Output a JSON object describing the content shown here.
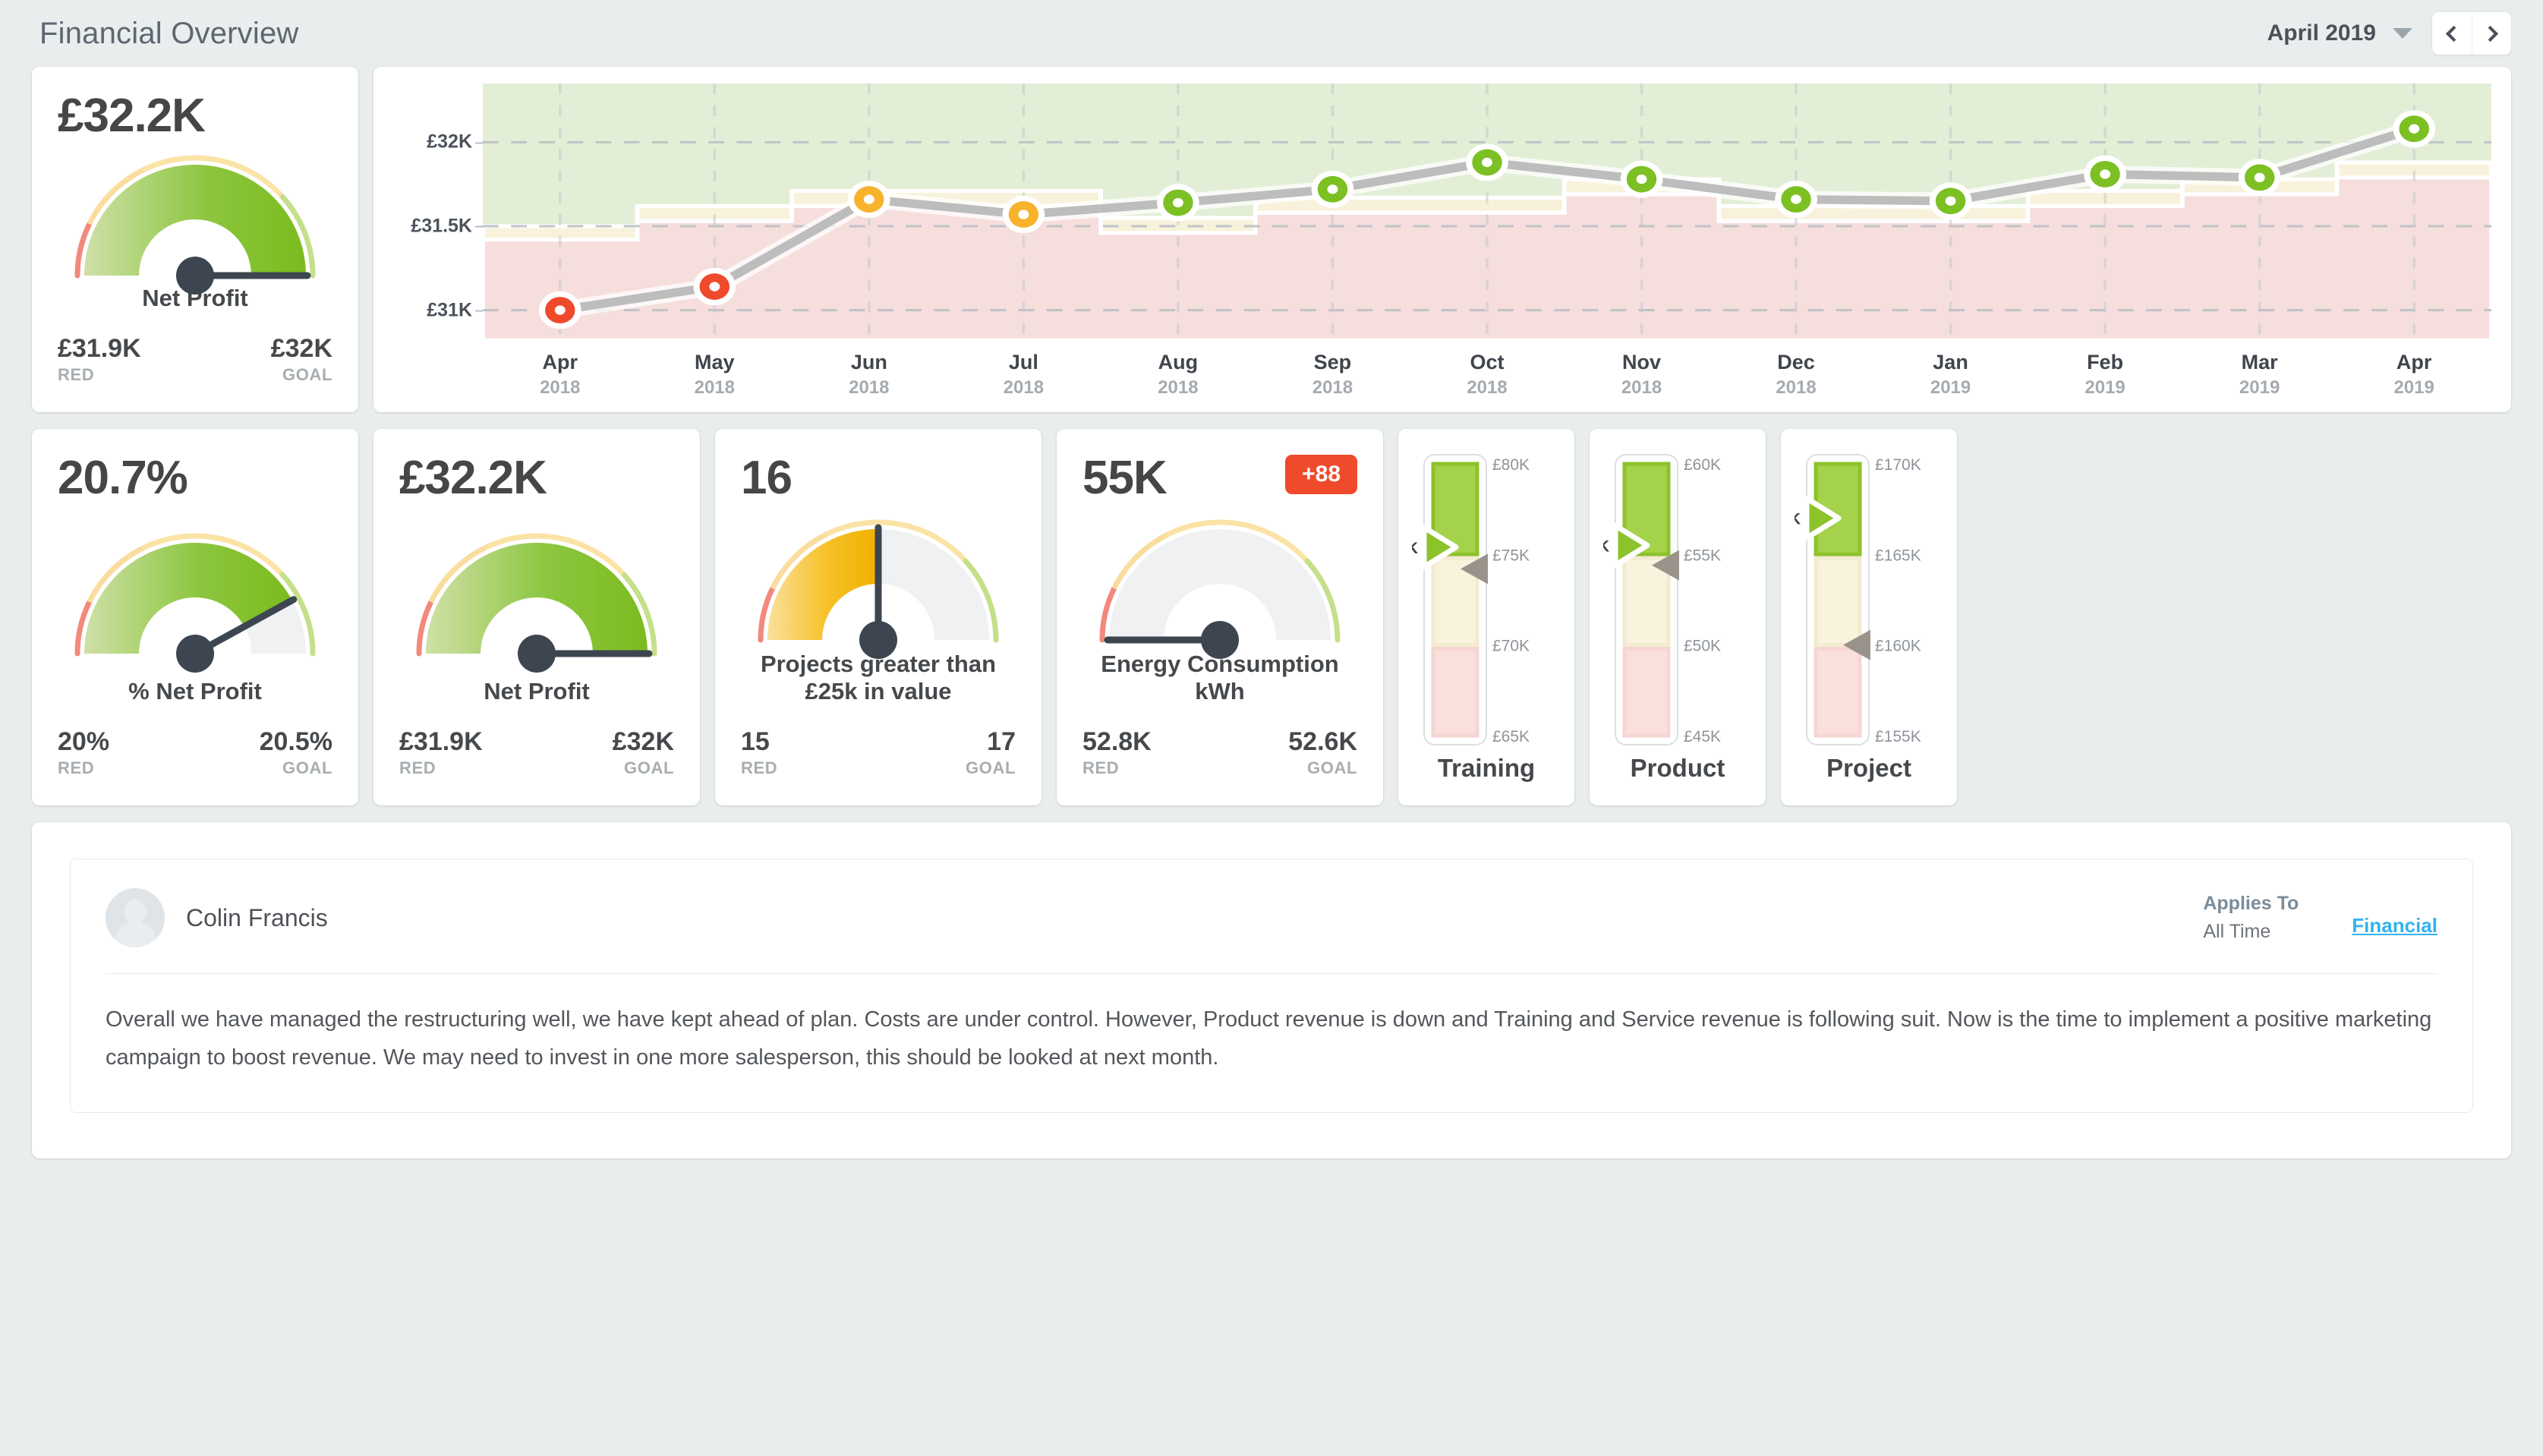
{
  "header": {
    "title": "Financial Overview",
    "period": "April 2019",
    "prev_label": "Previous period",
    "next_label": "Next period"
  },
  "net_profit_card": {
    "value": "£32.2K",
    "label": "Net Profit",
    "red_value": "£31.9K",
    "red_caption": "RED",
    "goal_value": "£32K",
    "goal_caption": "GOAL",
    "gauge": {
      "type": "green",
      "needle_pct": 100
    }
  },
  "pct_net_profit_card": {
    "value": "20.7%",
    "label": "% Net Profit",
    "red_value": "20%",
    "red_caption": "RED",
    "goal_value": "20.5%",
    "goal_caption": "GOAL",
    "gauge": {
      "type": "green",
      "needle_pct": 84
    }
  },
  "net_profit_card_2": {
    "value": "£32.2K",
    "label": "Net Profit",
    "red_value": "£31.9K",
    "red_caption": "RED",
    "goal_value": "£32K",
    "goal_caption": "GOAL",
    "gauge": {
      "type": "green",
      "needle_pct": 100
    }
  },
  "projects_card": {
    "value": "16",
    "label": "Projects greater than £25k in value",
    "label_line1": "Projects greater than",
    "label_line2": "£25k in value",
    "red_value": "15",
    "red_caption": "RED",
    "goal_value": "17",
    "goal_caption": "GOAL",
    "gauge": {
      "type": "amber",
      "needle_pct": 50
    }
  },
  "energy_card": {
    "value": "55K",
    "badge": "+88",
    "badge_color": "#f04a2c",
    "label_line1": "Energy Consumption",
    "label_line2": "kWh",
    "red_value": "52.8K",
    "red_caption": "RED",
    "goal_value": "52.6K",
    "goal_caption": "GOAL",
    "gauge": {
      "type": "red",
      "needle_pct": 0
    }
  },
  "bullets": [
    {
      "label": "Training",
      "value_label": "£75.4K",
      "value": 75.4,
      "ticks": [
        "£80K",
        "£75K",
        "£70K",
        "£65K"
      ],
      "scale_max": 80,
      "scale_min": 65,
      "target": 74.2,
      "bands": [
        {
          "color": "green",
          "from": 75.0,
          "to": 80.0
        },
        {
          "color": "amber",
          "from": 70.0,
          "to": 74.8
        },
        {
          "color": "red",
          "from": 65.0,
          "to": 69.8
        }
      ]
    },
    {
      "label": "Product",
      "value_label": "£55.5K",
      "value": 55.5,
      "ticks": [
        "£60K",
        "£55K",
        "£50K",
        "£45K"
      ],
      "scale_max": 60,
      "scale_min": 45,
      "target": 54.4,
      "bands": [
        {
          "color": "green",
          "from": 55.0,
          "to": 60.0
        },
        {
          "color": "amber",
          "from": 50.0,
          "to": 54.8
        },
        {
          "color": "red",
          "from": 45.0,
          "to": 49.8
        }
      ]
    },
    {
      "label": "Project",
      "value_label": "£167K",
      "value": 167.0,
      "ticks": [
        "£170K",
        "£165K",
        "£160K",
        "£155K"
      ],
      "scale_max": 170,
      "scale_min": 155,
      "target": 160.0,
      "bands": [
        {
          "color": "green",
          "from": 165.0,
          "to": 170.0
        },
        {
          "color": "amber",
          "from": 160.0,
          "to": 164.8
        },
        {
          "color": "red",
          "from": 155.0,
          "to": 159.8
        }
      ]
    }
  ],
  "comment": {
    "author": "Colin Francis",
    "applies_to_label": "Applies To",
    "applies_to_value": "All Time",
    "link": "Financial",
    "body": "Overall we have managed the restructuring well, we have kept ahead of plan. Costs are under control. However, Product revenue is down and Training and Service revenue is following suit. Now is the time to implement a positive marketing campaign to boost revenue. We may need to invest in one more salesperson, this should be looked at next month."
  },
  "chart_data": {
    "type": "line",
    "title": "",
    "xlabel": "",
    "ylabel": "",
    "ylim": [
      30.82,
      32.35
    ],
    "yticks": [
      31.0,
      31.5,
      32.0
    ],
    "ytick_labels": [
      "£31K",
      "£31.5K",
      "£32K"
    ],
    "grid": true,
    "legend": false,
    "categories": [
      "Apr 2018",
      "May 2018",
      "Jun 2018",
      "Jul 2018",
      "Aug 2018",
      "Sep 2018",
      "Oct 2018",
      "Nov 2018",
      "Dec 2018",
      "Jan 2019",
      "Feb 2019",
      "Mar 2019",
      "Apr 2019"
    ],
    "months": [
      "Apr",
      "May",
      "Jun",
      "Jul",
      "Aug",
      "Sep",
      "Oct",
      "Nov",
      "Dec",
      "Jan",
      "Feb",
      "Mar",
      "Apr"
    ],
    "years": [
      "2018",
      "2018",
      "2018",
      "2018",
      "2018",
      "2018",
      "2018",
      "2018",
      "2018",
      "2019",
      "2019",
      "2019",
      "2019"
    ],
    "series": [
      {
        "name": "Net Profit",
        "values": [
          31.0,
          31.14,
          31.66,
          31.57,
          31.64,
          31.72,
          31.88,
          31.78,
          31.66,
          31.65,
          31.81,
          31.79,
          32.08
        ],
        "point_status": [
          "red",
          "red",
          "amber",
          "amber",
          "green",
          "green",
          "green",
          "green",
          "green",
          "green",
          "green",
          "green",
          "green"
        ]
      }
    ],
    "bands": {
      "red_upper": [
        31.42,
        31.53,
        31.62,
        31.62,
        31.46,
        31.58,
        31.58,
        31.69,
        31.53,
        31.53,
        31.62,
        31.69,
        31.79
      ],
      "amber_upper": [
        31.5,
        31.62,
        31.71,
        31.71,
        31.55,
        31.67,
        31.67,
        31.78,
        31.62,
        31.62,
        31.71,
        31.78,
        31.88
      ]
    },
    "band_colors": {
      "green": "#e3eed6",
      "amber": "#f8f2dc",
      "red": "#f6dedd"
    },
    "point_colors": {
      "red": "#f04a2c",
      "amber": "#f7b32c",
      "green": "#7cc023"
    },
    "line_color": "#bdbdbd"
  }
}
